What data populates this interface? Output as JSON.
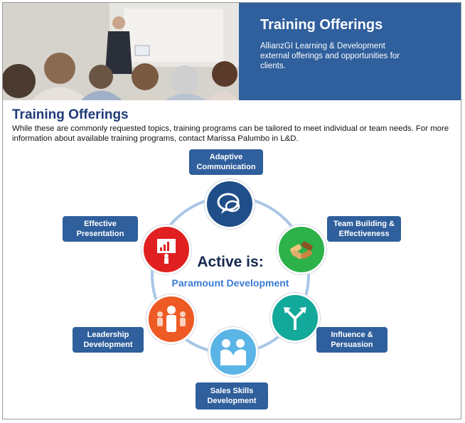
{
  "banner": {
    "title": "Training Offerings",
    "description": "AllianzGI Learning & Development external offerings and opportunities for clients."
  },
  "section": {
    "title": "Training Offerings",
    "description": "While these are commonly requested topics, training programs can be tailored to meet individual or team needs. For more information about available training programs, contact Marissa Palumbo in L&D."
  },
  "diagram": {
    "center_title": "Active is:",
    "center_subtitle": "Paramount Development",
    "items": [
      {
        "label": "Adaptive Communication",
        "icon": "speech-bubbles-icon",
        "color": "#1f4e89"
      },
      {
        "label": "Team Building & Effectiveness",
        "icon": "joined-hands-icon",
        "color": "#2db24a"
      },
      {
        "label": "Influence & Persuasion",
        "icon": "diverging-arrows-icon",
        "color": "#12a89a"
      },
      {
        "label": "Sales Skills Development",
        "icon": "handshake-icon",
        "color": "#5ab4e6"
      },
      {
        "label": "Leadership Development",
        "icon": "leader-group-icon",
        "color": "#ee5a24"
      },
      {
        "label": "Effective Presentation",
        "icon": "presenter-chart-icon",
        "color": "#e02020"
      }
    ]
  },
  "colors": {
    "label_bg": "#2f5f9c",
    "ring": "#a9c6e6",
    "title": "#1f3a78"
  }
}
